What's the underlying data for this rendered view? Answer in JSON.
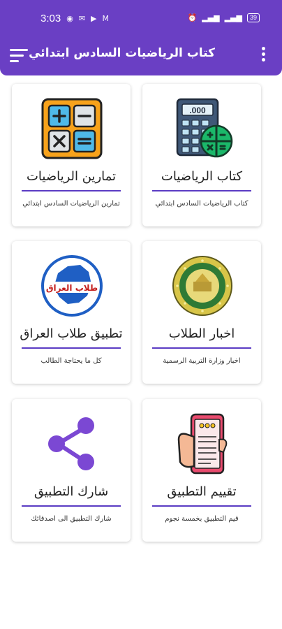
{
  "status_bar": {
    "time": "3:03",
    "notification_icons": [
      "whatsapp-icon",
      "mail-icon",
      "youtube-icon",
      "gmail-icon"
    ],
    "system_icons": [
      "alarm-icon",
      "signal-icon",
      "signal-icon",
      "battery-icon"
    ],
    "battery": "39"
  },
  "app_bar": {
    "title": "كتاب الرياضيات السادس ابتدائي"
  },
  "cards": [
    {
      "id": "math-book",
      "title": "كتاب الرياضيات",
      "subtitle": "كتاب الرياضيات السادس ابتدائي",
      "icon": "calculator-icon"
    },
    {
      "id": "math-exercises",
      "title": "تمارين الرياضيات",
      "subtitle": "تمارين الرياضيات السادس ابتدائي",
      "icon": "math-symbols-icon"
    },
    {
      "id": "student-news",
      "title": "اخبار الطلاب",
      "subtitle": "اخبار وزارة التربية الرسمية",
      "icon": "ministry-logo-icon"
    },
    {
      "id": "iraq-students-app",
      "title": "تطبيق طلاب العراق",
      "subtitle": "كل ما يحتاجة الطالب",
      "icon": "iraq-map-icon",
      "logo_text": "طلاب العراق"
    },
    {
      "id": "rate-app",
      "title": "تقييم التطبيق",
      "subtitle": "قيم التطبيق بخمسة نجوم",
      "icon": "rating-phone-icon"
    },
    {
      "id": "share-app",
      "title": "شارك التطبيق",
      "subtitle": "شارك التطبيق الى اصدقائك",
      "icon": "share-icon"
    }
  ],
  "colors": {
    "primary": "#6a3fc4",
    "divider": "#5b3cc4",
    "share": "#7b48d3"
  }
}
